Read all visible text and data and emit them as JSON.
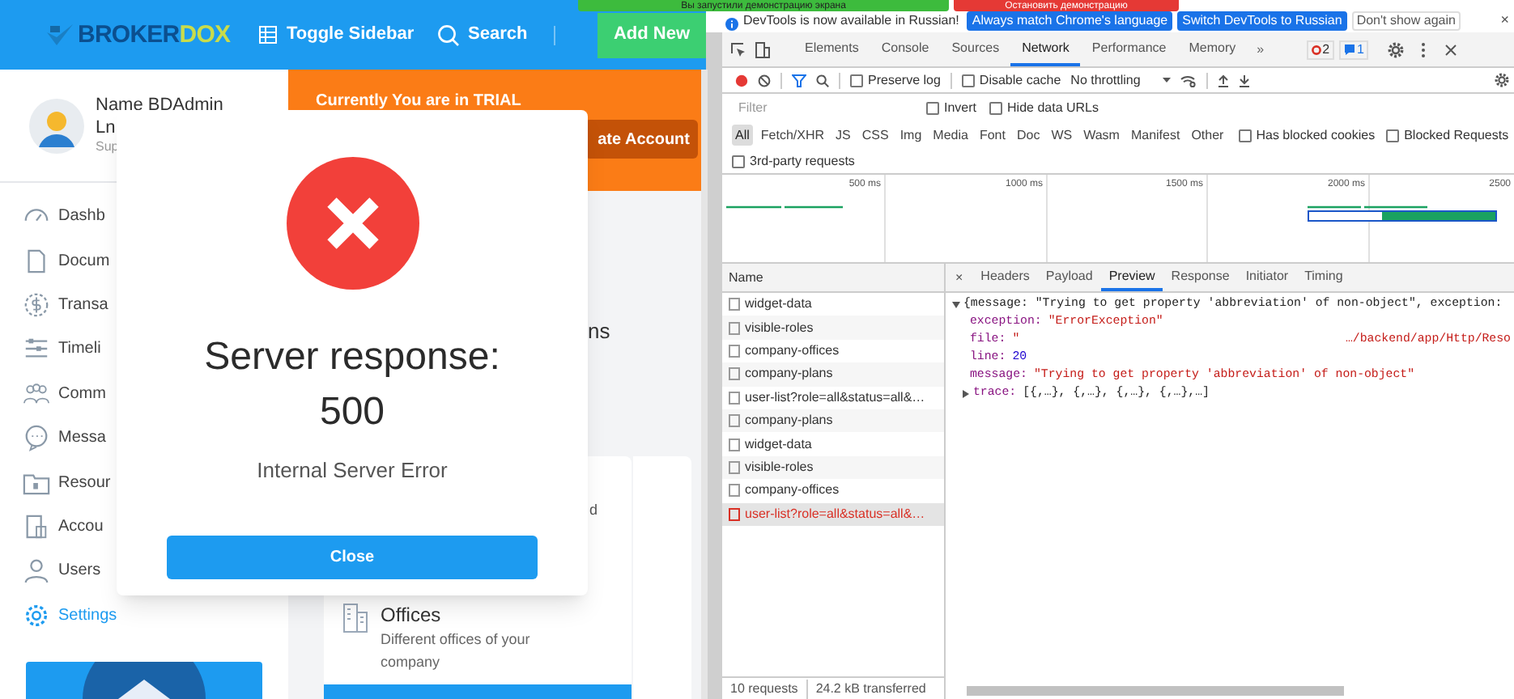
{
  "screen_share_bar": {
    "message": "Вы запустили демонстрацию экрана",
    "stop_button": "Остановить демонстрацию"
  },
  "app": {
    "logo": {
      "part_1": "BROKER",
      "part_2": "DOX"
    },
    "header": {
      "toggle_sidebar": "Toggle Sidebar",
      "search": "Search",
      "add_new": "Add New"
    },
    "profile": {
      "name": "Name BDAdmin",
      "line_2": "Ln",
      "role": "Sup"
    },
    "nav": [
      {
        "label": "Dashb",
        "selected": false
      },
      {
        "label": "Docum",
        "selected": false
      },
      {
        "label": "Transa",
        "selected": false
      },
      {
        "label": "Timeli",
        "selected": false
      },
      {
        "label": "Comm",
        "selected": false
      },
      {
        "label": "Messa",
        "selected": false
      },
      {
        "label": "Resour",
        "selected": false
      },
      {
        "label": "Accou",
        "selected": false
      },
      {
        "label": "Users",
        "selected": false
      },
      {
        "label": "Settings",
        "selected": true
      }
    ],
    "trial_banner": {
      "text": "Currently You are in TRIAL",
      "button": "ate Account"
    },
    "section_title": "ns",
    "card": {
      "text_fragment": "d",
      "title": "Offices",
      "description": "Different offices of your company"
    }
  },
  "modal": {
    "title": "Server response:",
    "code": "500",
    "message": "Internal Server Error",
    "button": "Close"
  },
  "devtools": {
    "infobar": {
      "message": "DevTools is now available in Russian!",
      "buttons": [
        {
          "label": "Always match Chrome's language",
          "kind": "primary"
        },
        {
          "label": "Switch DevTools to Russian",
          "kind": "primary"
        },
        {
          "label": "Don't show again",
          "kind": "secondary"
        }
      ],
      "close": "×"
    },
    "tabs": [
      {
        "label": "Elements",
        "selected": false
      },
      {
        "label": "Console",
        "selected": false
      },
      {
        "label": "Sources",
        "selected": false
      },
      {
        "label": "Network",
        "selected": true
      },
      {
        "label": "Performance",
        "selected": false
      },
      {
        "label": "Memory",
        "selected": false
      }
    ],
    "more_tabs": "»",
    "errors": "2",
    "messages": "1",
    "toolbar": {
      "recording": true,
      "filter_active": true,
      "preserve_log": {
        "label": "Preserve log",
        "checked": false
      },
      "disable_cache": {
        "label": "Disable cache",
        "checked": false
      },
      "throttling": "No throttling"
    },
    "filter": {
      "placeholder": "Filter",
      "invert": {
        "label": "Invert",
        "checked": false
      },
      "hide_data_urls": {
        "label": "Hide data URLs",
        "checked": false
      }
    },
    "types": [
      {
        "label": "All",
        "selected": true
      },
      {
        "label": "Fetch/XHR",
        "selected": false
      },
      {
        "label": "JS",
        "selected": false
      },
      {
        "label": "CSS",
        "selected": false
      },
      {
        "label": "Img",
        "selected": false
      },
      {
        "label": "Media",
        "selected": false
      },
      {
        "label": "Font",
        "selected": false
      },
      {
        "label": "Doc",
        "selected": false
      },
      {
        "label": "WS",
        "selected": false
      },
      {
        "label": "Wasm",
        "selected": false
      },
      {
        "label": "Manifest",
        "selected": false
      },
      {
        "label": "Other",
        "selected": false
      }
    ],
    "blocked_cookies": {
      "label": "Has blocked cookies",
      "checked": false
    },
    "blocked_requests": {
      "label": "Blocked Requests",
      "checked": false
    },
    "third_party": {
      "label": "3rd-party requests",
      "checked": false
    },
    "timeline": {
      "ticks": [
        "500 ms",
        "1000 ms",
        "1500 ms",
        "2000 ms",
        "2500"
      ]
    },
    "requests": {
      "column": "Name",
      "rows": [
        {
          "name": "widget-data",
          "failed": false,
          "selected": false
        },
        {
          "name": "visible-roles",
          "failed": false,
          "selected": false
        },
        {
          "name": "company-offices",
          "failed": false,
          "selected": false
        },
        {
          "name": "company-plans",
          "failed": false,
          "selected": false
        },
        {
          "name": "user-list?role=all&status=all&…",
          "failed": false,
          "selected": false
        },
        {
          "name": "company-plans",
          "failed": false,
          "selected": false
        },
        {
          "name": "widget-data",
          "failed": false,
          "selected": false
        },
        {
          "name": "visible-roles",
          "failed": false,
          "selected": false
        },
        {
          "name": "company-offices",
          "failed": false,
          "selected": false
        },
        {
          "name": "user-list?role=all&status=all&…",
          "failed": true,
          "selected": true
        }
      ]
    },
    "status": {
      "count": "10 requests",
      "transferred": "24.2 kB transferred"
    },
    "detail_close": "×",
    "detail_tabs": [
      {
        "label": "Headers",
        "selected": false
      },
      {
        "label": "Payload",
        "selected": false
      },
      {
        "label": "Preview",
        "selected": true
      },
      {
        "label": "Response",
        "selected": false
      },
      {
        "label": "Initiator",
        "selected": false
      },
      {
        "label": "Timing",
        "selected": false
      }
    ],
    "preview": {
      "summary": "{message: \"Trying to get property 'abbreviation' of non-object\", exception:",
      "expanded": true,
      "properties": [
        {
          "key": "exception:",
          "value": "\"ErrorException\"",
          "color": "#c41a16"
        },
        {
          "key": "file:",
          "value": "\"",
          "value_end": "…/backend/app/Http/Reso",
          "color": "#c41a16"
        },
        {
          "key": "line:",
          "value": "20",
          "color": "#1c00cf"
        },
        {
          "key": "message:",
          "value": "\"Trying to get property 'abbreviation' of non-object\"",
          "color": "#c41a16"
        }
      ],
      "trace": {
        "key": "trace:",
        "value": "[{,…}, {,…}, {,…}, {,…},…]",
        "expanded": false
      }
    }
  }
}
